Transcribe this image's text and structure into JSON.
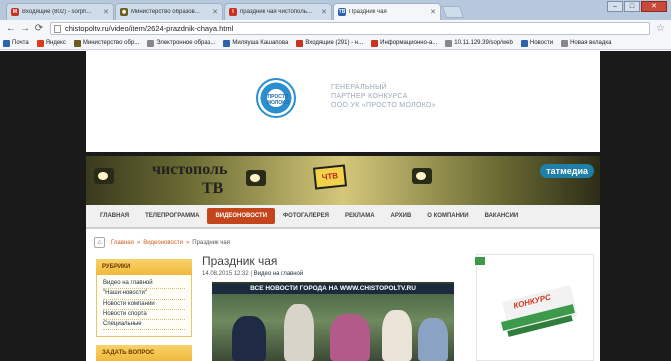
{
  "browser": {
    "tabs": [
      {
        "label": "Входящие (802) - sorph...",
        "icon_color": "#c8321e",
        "icon": "M",
        "active": false
      },
      {
        "label": "Министерство образов...",
        "icon_color": "#6b5b1e",
        "icon": "◉",
        "active": false
      },
      {
        "label": "праздник чая чистополь...",
        "icon_color": "#c8321e",
        "icon": "I",
        "active": false
      },
      {
        "label": "Праздник чая",
        "icon_color": "#2c62a8",
        "icon": "TB",
        "active": true
      }
    ],
    "url": "chistopoltv.ru/video/item/2624-prazdnik-chaya.html",
    "bookmarks": [
      {
        "label": "Почта",
        "icon_color": "#2c62a8"
      },
      {
        "label": "Яндекс",
        "icon_color": "#e03a1e"
      },
      {
        "label": "Министерство обр...",
        "icon_color": "#6b5b1e"
      },
      {
        "label": "Электронное образ...",
        "icon_color": "#888888"
      },
      {
        "label": "Миляуша Кашапова",
        "icon_color": "#2c62a8"
      },
      {
        "label": "Входящие (291) - н...",
        "icon_color": "#c8321e"
      },
      {
        "label": "Информационно-а...",
        "icon_color": "#c8321e"
      },
      {
        "label": "10.11.129.39/sop/web",
        "icon_color": "#888888"
      },
      {
        "label": "Новости",
        "icon_color": "#2c62a8"
      },
      {
        "label": "Новая вкладка",
        "icon_color": "#888888"
      }
    ]
  },
  "site": {
    "logo_text": "ПРОСТО МОЛОКО",
    "sponsor_lines": [
      "ГЕНЕРАЛЬНЫЙ",
      "ПАРТНЕР КОНКУРСА",
      "ООО УК «ПРОСТО МОЛОКО»"
    ],
    "banner_main": "чистополь",
    "banner_sub": "ТВ",
    "banner_box": "ЧТВ",
    "tatmedia": "татмедиа",
    "nav": [
      {
        "label": "ГЛАВНАЯ",
        "active": false
      },
      {
        "label": "ТЕЛЕПРОГРАММА",
        "active": false
      },
      {
        "label": "ВИДЕОНОВОСТИ",
        "active": true
      },
      {
        "label": "ФОТОГАЛЕРЕЯ",
        "active": false
      },
      {
        "label": "РЕКЛАМА",
        "active": false
      },
      {
        "label": "АРХИВ",
        "active": false
      },
      {
        "label": "О КОМПАНИИ",
        "active": false
      },
      {
        "label": "ВАКАНСИИ",
        "active": false
      }
    ],
    "breadcrumb": [
      "Главная",
      "Видеоновости",
      "Праздник чая"
    ],
    "rubrics_title": "РУБРИКИ",
    "rubrics": [
      "Видео на главной",
      "\"Наши новости\"",
      "Новости компании",
      "Новости спорта",
      "Специальные"
    ],
    "ask_title": "ЗАДАТЬ ВОПРОС",
    "article_title": "Праздник чая",
    "article_date": "14.08.2015 12:32",
    "article_category": "Видео на главной",
    "video_banner": "ВСЕ НОВОСТИ ГОРОДА НА WWW.CHISTOPOLTV.RU",
    "promo_title": "КОНКУРС"
  }
}
